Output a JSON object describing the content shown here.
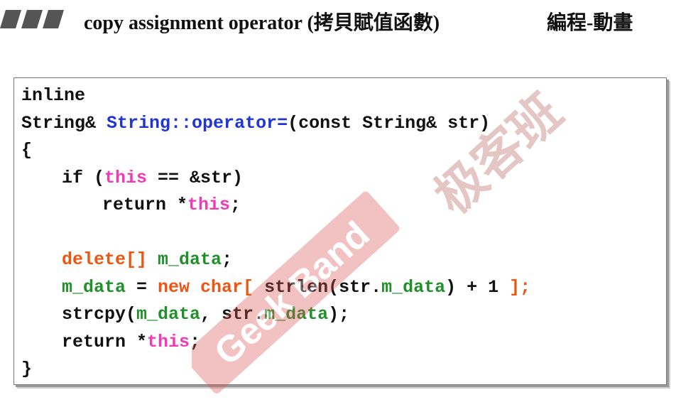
{
  "header": {
    "title": "copy assignment operator (拷貝賦值函數)",
    "subtitle": "編程-動畫"
  },
  "watermark": {
    "brand": "Geek Band",
    "cn": "极客班"
  },
  "code": {
    "l1": "inline",
    "l2a": "String& ",
    "l2b": "String::operator=",
    "l2c": "(const String& str)",
    "l3": "{",
    "l4a": "if (",
    "l4b": "this",
    "l4c": " == &str)",
    "l5a": "return *",
    "l5b": "this",
    "l5c": ";",
    "l7a": "delete[]",
    "l7b": " ",
    "l7c": "m_data",
    "l7d": ";",
    "l8a": "m_data",
    "l8b": " = ",
    "l8c": "new char[",
    "l8d": " strlen(str.",
    "l8e": "m_data",
    "l8f": ") + 1 ",
    "l8g": "];",
    "l9a": "strcpy(",
    "l9b": "m_data",
    "l9c": ", str.",
    "l9d": "m_data",
    "l9e": ");",
    "l10a": "return *",
    "l10b": "this",
    "l10c": ";",
    "l11": "}"
  },
  "colors": {
    "blue": "#1f35d6",
    "pink": "#ee3bb8",
    "red": "#ee5511",
    "green": "#22902a",
    "watermark": "#d9534f"
  }
}
